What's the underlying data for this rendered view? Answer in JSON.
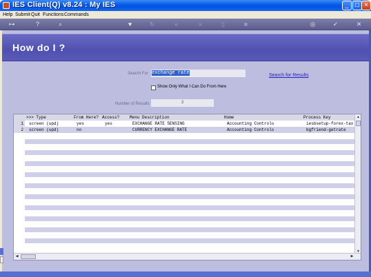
{
  "window": {
    "title": "IES Client(Q) v8.24 : My IES"
  },
  "menu": [
    "Help",
    "Submit",
    "Quit",
    "Functions",
    "Commands"
  ],
  "toolbar_icons": [
    "key-icon",
    "help-icon",
    "search-icon",
    "heart-icon",
    "refresh-icon",
    "back-icon",
    "forward-icon",
    "document-icon",
    "stop-icon",
    "globe-icon",
    "check-icon",
    "close-icon"
  ],
  "page": {
    "title": "How do I ?"
  },
  "search": {
    "label": "Search For",
    "value": "exchange rate",
    "link": "Search for Results"
  },
  "filter": {
    "label": "Show Only What I Can Do From Here",
    "checked": false
  },
  "results": {
    "label": "Number of Results",
    "value": "3"
  },
  "grid": {
    "columns": [
      ">>> Type",
      "From Here?",
      "Access?",
      "Menu Description",
      "Home",
      "Process Key"
    ],
    "rows": [
      {
        "num": "1",
        "type": "screen (upd)",
        "from_here": "yes",
        "access": "yes",
        "description": "EXCHANGE RATE SENSING",
        "home": "Accounting Controls",
        "key": "iesbsetup-forex-tax"
      },
      {
        "num": "2",
        "type": "screen (upd)",
        "from_here": "no",
        "access": "",
        "description": "CURRENCY EXCHANGE RATE",
        "home": "Accounting Controls",
        "key": "bgfriend-getrate"
      }
    ]
  },
  "colors": {
    "header_band": "#5a5ab8",
    "panel": "#bdbde0",
    "link": "#2020d0"
  }
}
